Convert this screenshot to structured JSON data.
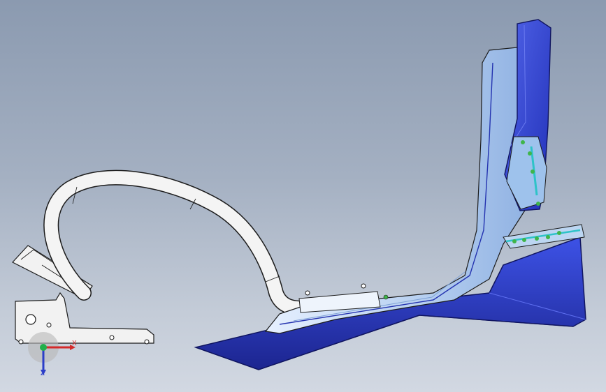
{
  "viewport": {
    "background_top": "#8b9ab0",
    "background_bottom": "#d2d8e2"
  },
  "model": {
    "colors": {
      "blue_surface": "#2f3fd0",
      "blue_dark": "#1c2590",
      "light_blue": "#c9dcf4",
      "cyan_accent": "#2ec3c8",
      "green_marker": "#3fb54a",
      "bracket": "#f2f2f2",
      "outline": "#1c1c1c"
    }
  },
  "triad": {
    "x_label": "X",
    "z_label": "Z",
    "x_color": "#d42a2a",
    "y_color": "#22b04a",
    "z_color": "#2c3ec8"
  }
}
